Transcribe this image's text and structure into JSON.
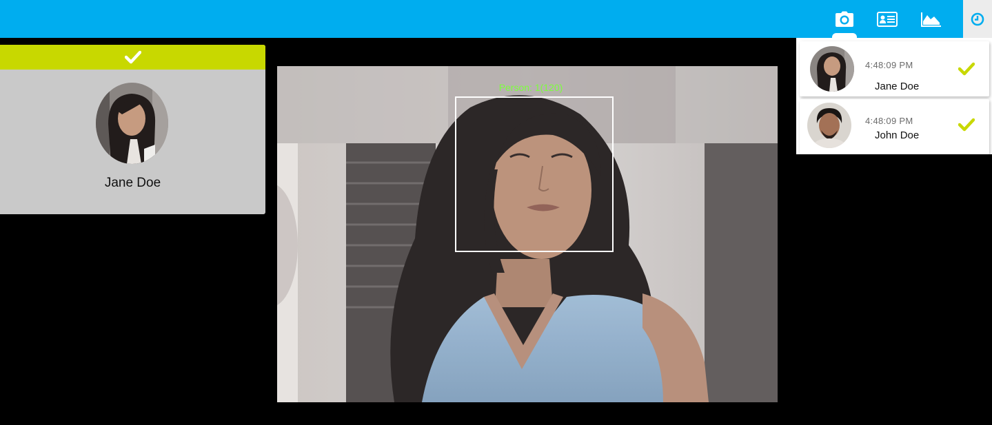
{
  "toolbar": {
    "buttons": [
      {
        "name": "camera-icon",
        "label": "Camera",
        "active": true
      },
      {
        "name": "id-card-icon",
        "label": "Persons",
        "active": false
      },
      {
        "name": "area-chart-icon",
        "label": "Statistics",
        "active": false
      }
    ],
    "history_icon": "clock-icon"
  },
  "match": {
    "status_icon": "check-icon",
    "name": "Jane Doe"
  },
  "camera": {
    "face_label": "Person: 1(120)"
  },
  "recent": [
    {
      "time": "4:48:09 PM",
      "name": "Jane Doe",
      "status": "recognized"
    },
    {
      "time": "4:48:09 PM",
      "name": "John Doe",
      "status": "recognized"
    }
  ],
  "colors": {
    "topbar": "#00adef",
    "accent": "#c8d800",
    "card": "#c9c9c9",
    "face_label": "#7dff3c"
  }
}
